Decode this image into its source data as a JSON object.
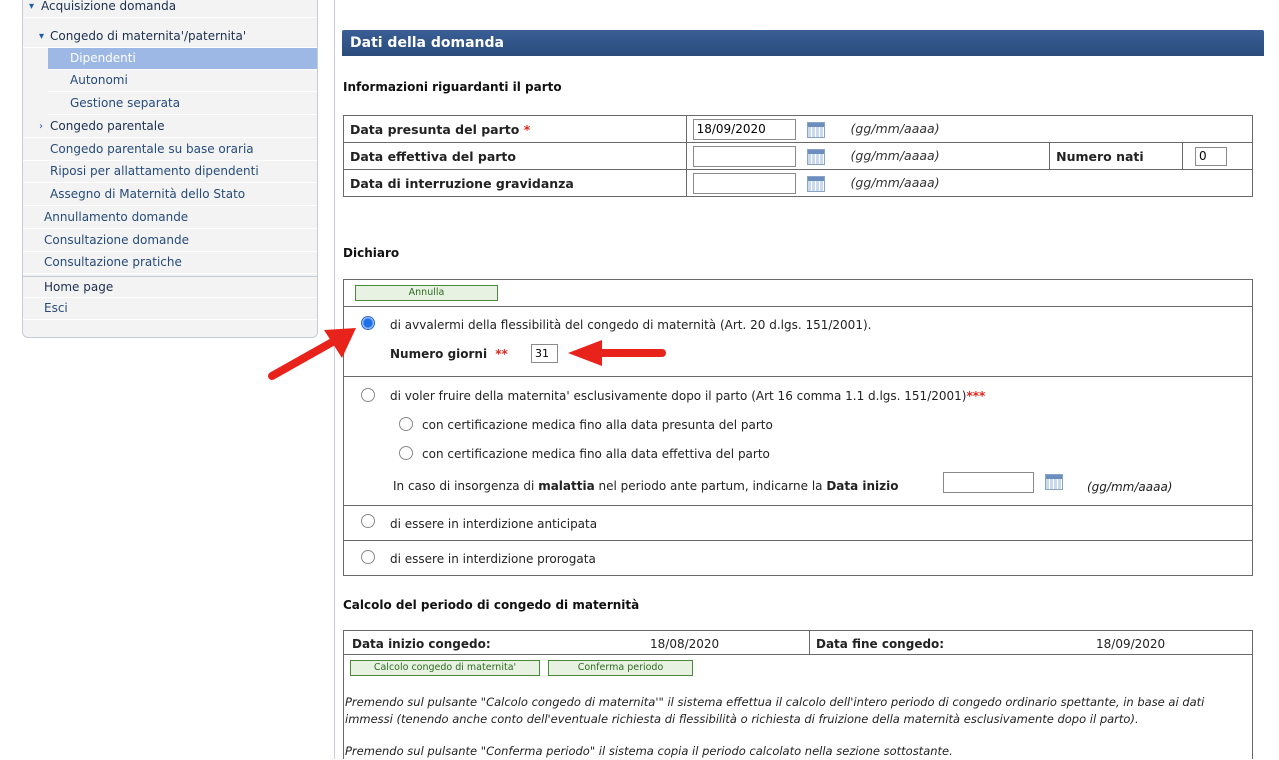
{
  "sidebar": {
    "items": [
      {
        "label": "Acquisizione domanda",
        "expanded": true
      },
      {
        "label": "Congedo di maternita'/paternita'",
        "expanded": true
      },
      {
        "label": "Dipendenti",
        "selected": true
      },
      {
        "label": "Autonomi"
      },
      {
        "label": "Gestione separata"
      },
      {
        "label": "Congedo parentale",
        "expanded": false
      },
      {
        "label": "Congedo parentale su base oraria"
      },
      {
        "label": "Riposi per allattamento dipendenti"
      },
      {
        "label": "Assegno di Maternità dello Stato"
      },
      {
        "label": "Annullamento domande"
      },
      {
        "label": "Consultazione domande"
      },
      {
        "label": "Consultazione pratiche"
      },
      {
        "label": "Home page"
      },
      {
        "label": "Esci"
      }
    ]
  },
  "header": {
    "title": "Dati della domanda"
  },
  "parto": {
    "section_title": "Informazioni riguardanti il parto",
    "presunta_label": "Data presunta del parto",
    "presunta_value": "18/09/2020",
    "effettiva_label": "Data effettiva del parto",
    "effettiva_value": "",
    "interruzione_label": "Data di interruzione gravidanza",
    "interruzione_value": "",
    "date_hint": "(gg/mm/aaaa)",
    "numero_nati_label": "Numero nati",
    "numero_nati_value": "0",
    "required_mark": "*"
  },
  "dichiaro": {
    "section_title": "Dichiaro",
    "annulla_label": "Annulla",
    "opt1_text": "di avvalermi della flessibilità del congedo di maternità (Art. 20 d.lgs. 151/2001).",
    "numero_giorni_label": "Numero giorni",
    "numero_giorni_mark": "**",
    "numero_giorni_value": "31",
    "opt2_text": "di voler fruire della maternita' esclusivamente dopo il parto (Art 16 comma 1.1 d.lgs. 151/2001)",
    "opt2_mark": "***",
    "sub1_text": "con certificazione medica fino alla data presunta del parto",
    "sub2_text": "con certificazione medica fino alla data effettiva del parto",
    "malattia_pre": "In caso di insorgenza di",
    "malattia_bold": "malattia",
    "malattia_mid": "nel periodo ante partum, indicarne la",
    "malattia_bold2": "Data inizio",
    "malattia_value": "",
    "malattia_hint": "(gg/mm/aaaa)",
    "opt3_text": "di essere in interdizione anticipata",
    "opt4_text": "di essere in interdizione prorogata",
    "selected_option": 1
  },
  "calcolo": {
    "section_title": "Calcolo del periodo di congedo di maternità",
    "inizio_label": "Data inizio congedo:",
    "inizio_value": "18/08/2020",
    "fine_label": "Data fine congedo:",
    "fine_value": "18/09/2020",
    "btn_calcolo": "Calcolo congedo di maternita'",
    "btn_conferma": "Conferma periodo",
    "note1": "Premendo sul pulsante \"Calcolo congedo di maternita'\" il sistema effettua il calcolo dell'intero periodo di congedo ordinario spettante, in base ai dati immessi (tenendo anche conto dell'eventuale richiesta di flessibilità o richiesta di fruizione della maternità esclusivamente dopo il parto).",
    "note2": "Premendo sul pulsante \"Conferma periodo\" il sistema copia il periodo calcolato nella sezione sottostante."
  },
  "colors": {
    "header_bg": "#2f5286",
    "selected_nav": "#9db8e5",
    "required": "#e2231a",
    "arrow": "#e8231c"
  }
}
